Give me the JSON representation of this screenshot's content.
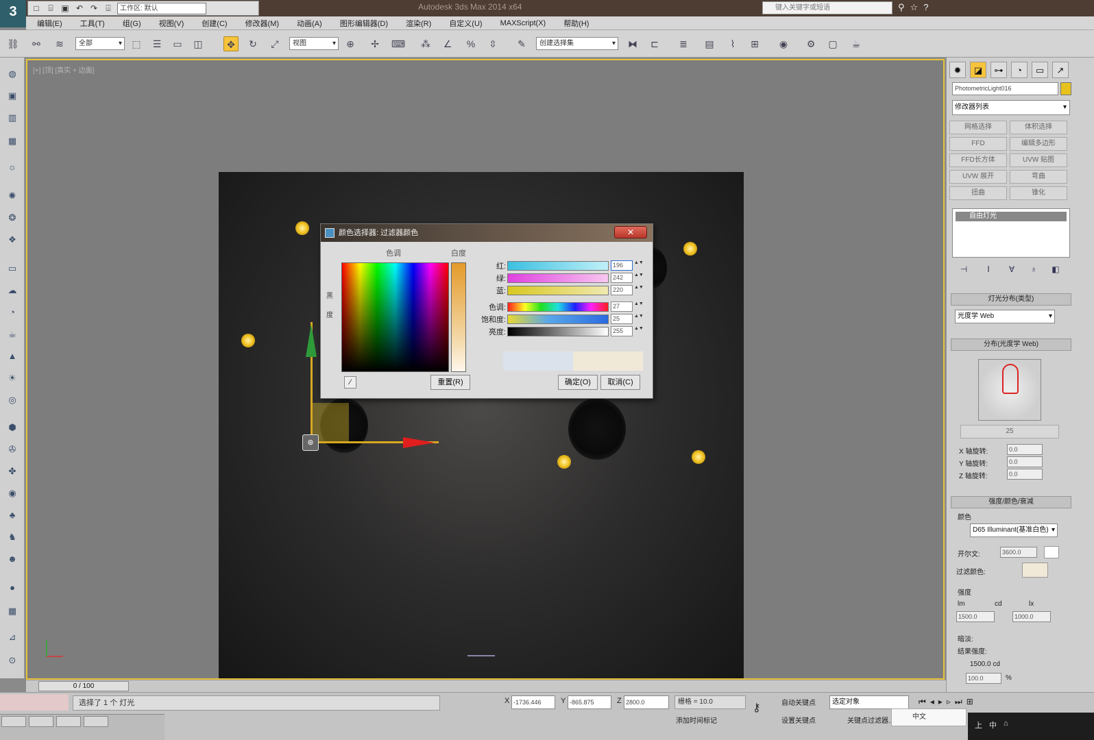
{
  "title_bar": {
    "title": "Autodesk 3ds Max 2014 x64",
    "quick_access": [
      "new-icon",
      "open-icon",
      "save-icon",
      "undo-icon",
      "redo-icon",
      "project-icon"
    ],
    "workspace": "工作区: 默认",
    "search_placeholder": "键入关键字或短语",
    "right_icons": [
      "binoculars-icon",
      "star-icon",
      "help-icon"
    ]
  },
  "menu": {
    "items": [
      "编辑(E)",
      "工具(T)",
      "组(G)",
      "视图(V)",
      "创建(C)",
      "修改器(M)",
      "动画(A)",
      "图形编辑器(D)",
      "渲染(R)",
      "自定义(U)",
      "MAXScript(X)",
      "帮助(H)"
    ]
  },
  "toolbar": {
    "filter_combo": "全部",
    "refcoord_combo": "视图",
    "named_selection_combo": "创建选择集"
  },
  "viewport": {
    "label": "[+] [顶] [真实 + 边面]"
  },
  "color_dialog": {
    "title": "颜色选择器: 过滤器颜色",
    "close_label": "✕",
    "hue_label": "色调",
    "whiteness_label": "白度",
    "blackness_label_1": "黑",
    "blackness_label_2": "度",
    "sliders": [
      {
        "label": "红:",
        "value": "196"
      },
      {
        "label": "绿:",
        "value": "242"
      },
      {
        "label": "蓝:",
        "value": "220"
      },
      {
        "label": "色调:",
        "value": "27"
      },
      {
        "label": "饱和度:",
        "value": "25"
      },
      {
        "label": "亮度:",
        "value": "255"
      }
    ],
    "reset_label": "重置(R)",
    "ok_label": "确定(O)",
    "cancel_label": "取消(C)",
    "old_color": "#dbe2ec",
    "new_color": "#f1e9d8"
  },
  "command_panel": {
    "object_name": "PhotometricLight016",
    "object_color": "#e8c21c",
    "modifier_list": "修改器列表",
    "buttons": [
      "网格选择",
      "体积选择",
      "FFD",
      "编辑多边形",
      "FFD长方体",
      "UVW 贴图",
      "UVW 展开",
      "弯曲",
      "扭曲",
      "锥化"
    ],
    "stack_item": "自由灯光",
    "distribution_rollout": "灯光分布(类型)",
    "distribution_value": "光度学 Web",
    "web_rollout": "分布(光度学 Web)",
    "web_file_button": "25",
    "x_rotation_label": "X 轴旋转:",
    "y_rotation_label": "Y 轴旋转:",
    "z_rotation_label": "Z 轴旋转:",
    "rotation_values": [
      "0.0",
      "0.0",
      "0.0"
    ],
    "intensity_rollout": "强度/颜色/衰减",
    "color_label": "颜色",
    "color_preset": "D65 Illuminant(基准白色)",
    "kelvin_label": "开尔文:",
    "kelvin_value": "3600.0",
    "filter_color_label": "过滤颜色:",
    "intensity_label": "强度",
    "unit_options": [
      "lm",
      "cd",
      "lx"
    ],
    "intensity_values": [
      "1500.0",
      "1000.0"
    ],
    "dimming_label": "暗淡:",
    "dimming_sub_label": "结果强度:",
    "dimming_result": "1500.0 cd",
    "dimming_percent": "100.0",
    "percent_sign": "%"
  },
  "timeline": {
    "slider_label": "0 / 100"
  },
  "status": {
    "message": "选择了 1 个 灯光",
    "x_value": "-1736.446",
    "y_value": "-865.875",
    "z_value": "2800.0",
    "grid": "栅格 = 10.0",
    "auto_key": "自动关键点",
    "selected": "选定对象",
    "set_key": "设置关键点",
    "key_filters": "关键点过滤器...",
    "add_time_tag": "添加时间标记",
    "popup": "中文",
    "tray": [
      "上",
      "中",
      "⌂"
    ]
  },
  "taskbar": {
    "items": [
      "",
      "",
      "",
      ""
    ]
  },
  "accent_colors": {
    "active": "#f6c33c",
    "viewport_border": "#e8c43a",
    "title_bar": "#4d3d33"
  }
}
